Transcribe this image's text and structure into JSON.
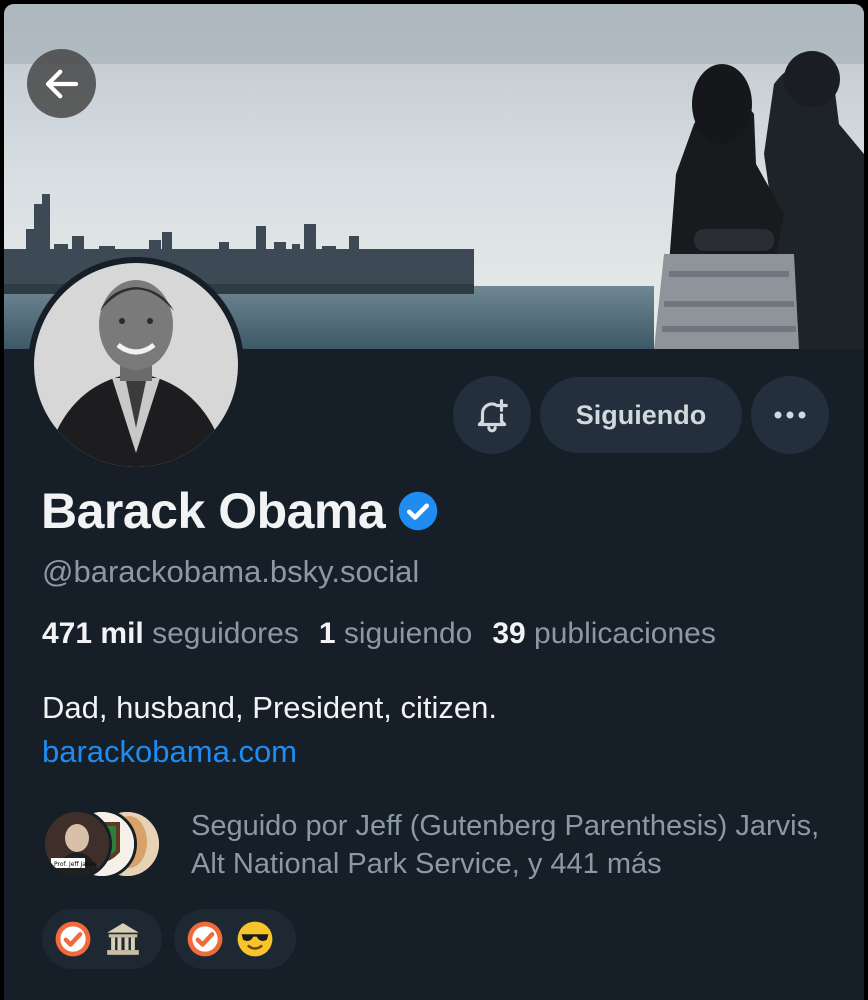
{
  "profile": {
    "display_name": "Barack Obama",
    "handle": "@barackobama.bsky.social",
    "verified": true,
    "bio": "Dad, husband, President, citizen.",
    "website": "barackobama.com"
  },
  "stats": {
    "followers_count": "471 mil",
    "followers_label": "seguidores",
    "following_count": "1",
    "following_label": "siguiendo",
    "posts_count": "39",
    "posts_label": "publicaciones"
  },
  "actions": {
    "following_label": "Siguiendo",
    "more_label": "···"
  },
  "followed_by": {
    "text": "Seguido por Jeff (Gutenberg Parenthesis) Jarvis, Alt National Park Service, y 441 más",
    "avatar_caption": "Prof. Jeff Jarvis"
  },
  "icons": {
    "back": "arrow-left-icon",
    "notify": "bell-plus-icon",
    "verified": "verified-check-icon",
    "more": "ellipsis-icon",
    "labels": [
      "check-badge-icon",
      "classical-building-icon",
      "check-badge-icon",
      "sunglasses-face-icon"
    ]
  },
  "colors": {
    "background": "#161e27",
    "surface": "#232f3c",
    "link": "#1e8cf0",
    "verified": "#1e8cf0",
    "muted_text": "#8b98a5",
    "label_badge": "#f06a3c"
  }
}
